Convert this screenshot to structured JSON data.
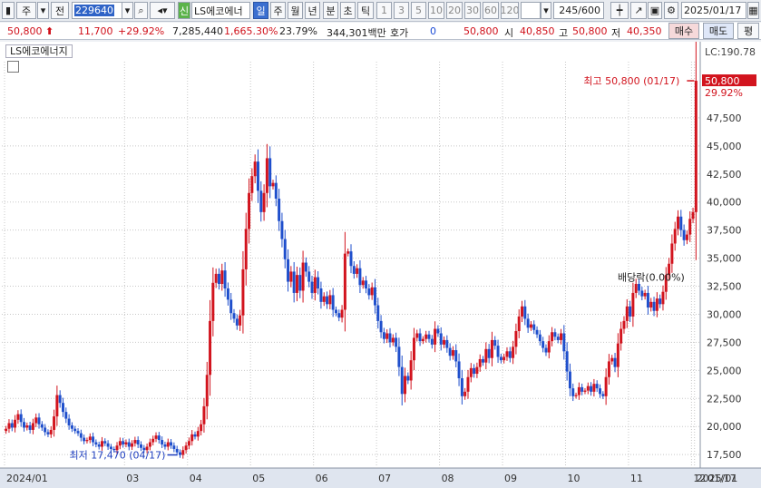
{
  "toolbar": {
    "market_type": "주",
    "prev_label": "전",
    "stock_code": "229640",
    "credit_badge": "신",
    "stock_name": "LS에코에너",
    "periods": [
      "일",
      "주",
      "월",
      "년",
      "분",
      "초",
      "틱"
    ],
    "active_period": "일",
    "intervals": [
      "1",
      "3",
      "5",
      "10",
      "20",
      "30",
      "60",
      "120"
    ],
    "count_display": "245/600",
    "date_value": "2025/01/17"
  },
  "quote": {
    "price": "50,800",
    "change": "11,700",
    "change_pct": "+29.92%",
    "volume": "7,285,440",
    "volume_pct": "1,665.30%",
    "turnover": "23.79%",
    "amount": "344,301백만",
    "hoga_label": "호가",
    "hoga_value": "0",
    "hoga_price": "50,800",
    "open_label": "시",
    "open": "40,850",
    "high_label": "고",
    "high": "50,800",
    "low_label": "저",
    "low": "40,350",
    "sell_button": "매수",
    "sell2_button": "매도",
    "eval_button": "평"
  },
  "chart_data": {
    "type": "candlestick",
    "title": "LS에코에너지",
    "lc_label": "LC:190.78",
    "current_price_label": "50,800",
    "current_pct_label": "29.92%",
    "y_ticks": [
      17500,
      20000,
      22500,
      25000,
      27500,
      30000,
      32500,
      35000,
      37500,
      40000,
      42500,
      45000,
      47500
    ],
    "ylim": [
      16300,
      52500
    ],
    "x_ticks": [
      "2024/01",
      "03",
      "04",
      "05",
      "06",
      "07",
      "08",
      "09",
      "10",
      "11",
      "12",
      "2025/01",
      "01/17"
    ],
    "annotations": {
      "high": "최고 50,800 (01/17)",
      "low": "최저 17,470 (04/17)",
      "dividend": "배당락(0.00%)"
    },
    "colors": {
      "up": "#d2141e",
      "down": "#1f4fcc",
      "grid": "#c8c8c8"
    },
    "closes": [
      19800,
      20300,
      19900,
      20600,
      21100,
      20400,
      19900,
      20100,
      19700,
      20300,
      20800,
      20200,
      19900,
      19500,
      19300,
      19700,
      20900,
      22800,
      22100,
      21300,
      20700,
      20100,
      19800,
      19600,
      19400,
      19000,
      18700,
      18800,
      19100,
      18600,
      18400,
      18200,
      18700,
      18500,
      18200,
      18000,
      17900,
      18300,
      18700,
      18400,
      18600,
      18200,
      18500,
      18800,
      18400,
      18100,
      17900,
      18200,
      18600,
      18900,
      19200,
      18800,
      18400,
      18200,
      18600,
      18300,
      18000,
      17700,
      17470,
      17900,
      18300,
      18700,
      19300,
      19100,
      19600,
      20200,
      21800,
      24600,
      29400,
      32800,
      33600,
      32700,
      33900,
      32300,
      31300,
      30100,
      29600,
      29000,
      29900,
      34000,
      37600,
      40800,
      42300,
      43600,
      41000,
      39100,
      40800,
      43900,
      41400,
      41700,
      40300,
      38300,
      36700,
      34900,
      32900,
      33800,
      31900,
      33500,
      32100,
      34600,
      33800,
      32900,
      31900,
      33300,
      32300,
      31100,
      31600,
      30900,
      31700,
      30400,
      30100,
      29700,
      30400,
      35400,
      35600,
      34300,
      33600,
      34100,
      32600,
      33000,
      32300,
      31700,
      32400,
      30800,
      29400,
      28400,
      27800,
      28300,
      27500,
      27900,
      27100,
      25300,
      22900,
      24500,
      24100,
      25900,
      27900,
      28300,
      27600,
      27800,
      28200,
      27800,
      27300,
      28700,
      28300,
      27300,
      27700,
      27000,
      26300,
      26800,
      25800,
      24300,
      22700,
      23100,
      24400,
      25200,
      24700,
      25300,
      26000,
      25700,
      26900,
      26100,
      27700,
      27200,
      26200,
      25900,
      26200,
      26700,
      26100,
      27100,
      28500,
      29800,
      30700,
      29600,
      28800,
      29100,
      28600,
      28200,
      27600,
      27000,
      26600,
      27600,
      28400,
      28000,
      27700,
      28300,
      26700,
      24900,
      23400,
      22700,
      22800,
      23500,
      23100,
      23200,
      23600,
      23100,
      23800,
      23400,
      22900,
      22700,
      24400,
      25800,
      26100,
      25300,
      27400,
      28700,
      29400,
      30700,
      29800,
      31900,
      32700,
      32100,
      31600,
      31900,
      30600,
      31100,
      30300,
      31400,
      30900,
      32000,
      33500,
      34500,
      36300,
      37600,
      38700,
      37500,
      36600,
      37100,
      38500,
      39100,
      50800
    ]
  }
}
